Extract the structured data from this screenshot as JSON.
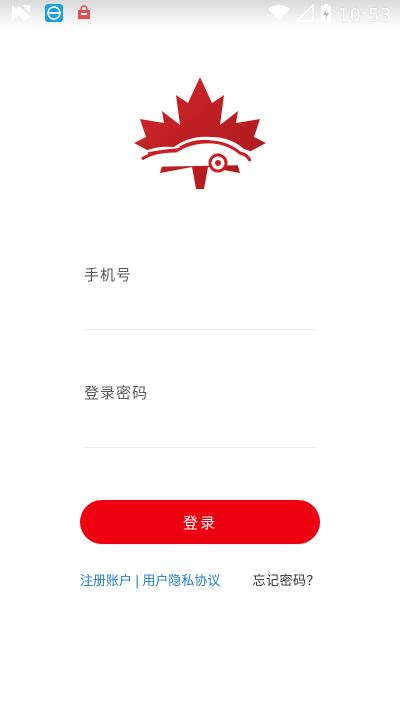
{
  "status_bar": {
    "time": "10:53",
    "icons": [
      "signal-icon",
      "app-notification-icon",
      "store-notification-icon",
      "wifi-icon",
      "no-signal-icon",
      "battery-charging-icon"
    ]
  },
  "logo": {
    "icon": "maple-leaf-car-logo",
    "color": "#c81e24"
  },
  "form": {
    "phone_label": "手机号",
    "password_label": "登录密码"
  },
  "login_button": {
    "label": "登录",
    "color": "#ee0011"
  },
  "links": {
    "register": "注册账户",
    "separator": "|",
    "privacy": "用户隐私协议",
    "forgot": "忘记密码？"
  }
}
